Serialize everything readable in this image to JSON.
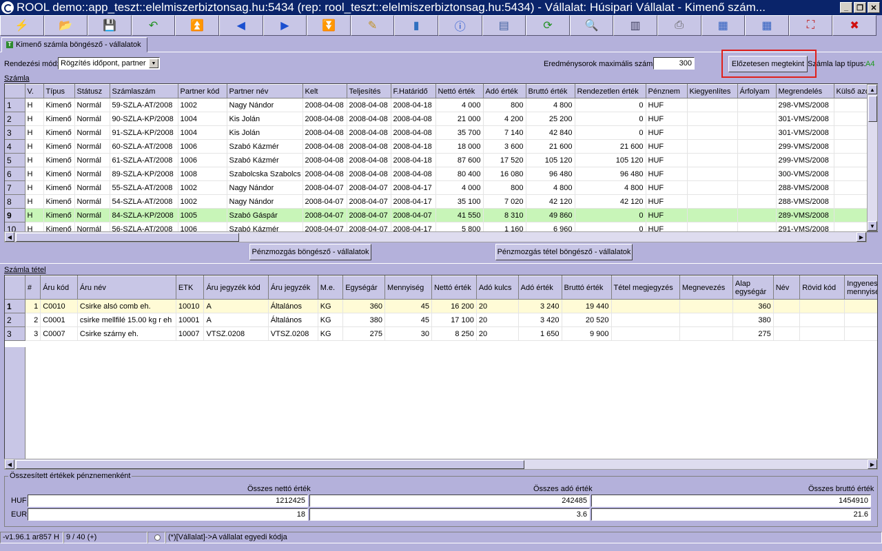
{
  "window": {
    "title": "ROOL demo::app_teszt::elelmiszerbiztonsag.hu:5434 (rep: rool_teszt::elelmiszerbiztonsag.hu:5434) - Vállalat: Húsipari Vállalat - Kimenő szám..."
  },
  "toolbar": {
    "buttons": [
      {
        "name": "new-icon",
        "glyph": "⚡",
        "color": "#d4781a"
      },
      {
        "name": "open-icon",
        "glyph": "📂",
        "color": "#3060c0"
      },
      {
        "name": "save-icon",
        "glyph": "💾",
        "color": "#303060"
      },
      {
        "name": "undo-icon",
        "glyph": "↶",
        "color": "#209020"
      },
      {
        "name": "first-record-icon",
        "glyph": "⏫",
        "color": "#1a4fd0"
      },
      {
        "name": "previous-record-icon",
        "glyph": "◀",
        "color": "#1a4fd0"
      },
      {
        "name": "next-record-icon",
        "glyph": "▶",
        "color": "#1a4fd0"
      },
      {
        "name": "last-record-icon",
        "glyph": "⏬",
        "color": "#1a4fd0"
      },
      {
        "name": "edit-icon",
        "glyph": "✎",
        "color": "#c09020"
      },
      {
        "name": "database-icon",
        "glyph": "▮",
        "color": "#3070c0"
      },
      {
        "name": "info-icon",
        "glyph": "ⓘ",
        "color": "#1a4fd0"
      },
      {
        "name": "layout-icon",
        "glyph": "▤",
        "color": "#4060a0"
      },
      {
        "name": "refresh-icon",
        "glyph": "⟳",
        "color": "#209020"
      },
      {
        "name": "search-icon",
        "glyph": "🔍",
        "color": "#3060c0"
      },
      {
        "name": "columns-icon",
        "glyph": "▥",
        "color": "#404060"
      },
      {
        "name": "print-icon",
        "glyph": "⎙",
        "color": "#606060"
      },
      {
        "name": "export-icon",
        "glyph": "▦",
        "color": "#3060c0"
      },
      {
        "name": "import-icon",
        "glyph": "▦",
        "color": "#3060c0"
      },
      {
        "name": "expand-icon",
        "glyph": "⛶",
        "color": "#c02020"
      },
      {
        "name": "close-icon",
        "glyph": "✖",
        "color": "#d01010"
      }
    ]
  },
  "tab": {
    "icon_letter": "T",
    "label": "Kimenő számla böngésző - vállalatok"
  },
  "controls": {
    "sort_label": "Rendezési mód:",
    "sort_value": "Rögzítés időpont, partner",
    "max_rows_label": "Eredménysorok maximális száma:",
    "max_rows_value": "300",
    "preview_button": "Előzetesen megtekint",
    "sheet_type_label": "Számla lap típus:",
    "sheet_type_value": "A4"
  },
  "invoices": {
    "section_label": "Számla",
    "columns": [
      "V.",
      "Típus",
      "Státusz",
      "Számlaszám",
      "Partner kód",
      "Partner név",
      "Kelt",
      "Teljesítés",
      "F.Határidő",
      "Nettó érték",
      "Adó érték",
      "Bruttó érték",
      "Rendezetlen érték",
      "Pénznem",
      "Kiegyenlítes",
      "Árfolyam",
      "Megrendelés",
      "Külső azo"
    ],
    "rows": [
      [
        "1",
        "H",
        "Kimenő",
        "Normál",
        "59-SZLA-AT/2008",
        "1002",
        "Nagy Nándor",
        "2008-04-08",
        "2008-04-08",
        "2008-04-18",
        "4 000",
        "800",
        "4 800",
        "0",
        "HUF",
        "",
        "",
        "298-VMS/2008",
        ""
      ],
      [
        "2",
        "H",
        "Kimenő",
        "Normál",
        "90-SZLA-KP/2008",
        "1004",
        "Kis Jolán",
        "2008-04-08",
        "2008-04-08",
        "2008-04-08",
        "21 000",
        "4 200",
        "25 200",
        "0",
        "HUF",
        "",
        "",
        "301-VMS/2008",
        ""
      ],
      [
        "3",
        "H",
        "Kimenő",
        "Normál",
        "91-SZLA-KP/2008",
        "1004",
        "Kis Jolán",
        "2008-04-08",
        "2008-04-08",
        "2008-04-08",
        "35 700",
        "7 140",
        "42 840",
        "0",
        "HUF",
        "",
        "",
        "301-VMS/2008",
        ""
      ],
      [
        "4",
        "H",
        "Kimenő",
        "Normál",
        "60-SZLA-AT/2008",
        "1006",
        "Szabó Kázmér",
        "2008-04-08",
        "2008-04-08",
        "2008-04-18",
        "18 000",
        "3 600",
        "21 600",
        "21 600",
        "HUF",
        "",
        "",
        "299-VMS/2008",
        ""
      ],
      [
        "5",
        "H",
        "Kimenő",
        "Normál",
        "61-SZLA-AT/2008",
        "1006",
        "Szabó Kázmér",
        "2008-04-08",
        "2008-04-08",
        "2008-04-18",
        "87 600",
        "17 520",
        "105 120",
        "105 120",
        "HUF",
        "",
        "",
        "299-VMS/2008",
        ""
      ],
      [
        "6",
        "H",
        "Kimenő",
        "Normál",
        "89-SZLA-KP/2008",
        "1008",
        "Szabolcska Szabolcs",
        "2008-04-08",
        "2008-04-08",
        "2008-04-08",
        "80 400",
        "16 080",
        "96 480",
        "96 480",
        "HUF",
        "",
        "",
        "300-VMS/2008",
        ""
      ],
      [
        "7",
        "H",
        "Kimenő",
        "Normál",
        "55-SZLA-AT/2008",
        "1002",
        "Nagy Nándor",
        "2008-04-07",
        "2008-04-07",
        "2008-04-17",
        "4 000",
        "800",
        "4 800",
        "4 800",
        "HUF",
        "",
        "",
        "288-VMS/2008",
        ""
      ],
      [
        "8",
        "H",
        "Kimenő",
        "Normál",
        "54-SZLA-AT/2008",
        "1002",
        "Nagy Nándor",
        "2008-04-07",
        "2008-04-07",
        "2008-04-17",
        "35 100",
        "7 020",
        "42 120",
        "42 120",
        "HUF",
        "",
        "",
        "288-VMS/2008",
        ""
      ],
      [
        "9",
        "H",
        "Kimenő",
        "Normál",
        "84-SZLA-KP/2008",
        "1005",
        "Szabó Gáspár",
        "2008-04-07",
        "2008-04-07",
        "2008-04-07",
        "41 550",
        "8 310",
        "49 860",
        "0",
        "HUF",
        "",
        "",
        "289-VMS/2008",
        ""
      ],
      [
        "10",
        "H",
        "Kimenő",
        "Normál",
        "56-SZLA-AT/2008",
        "1006",
        "Szabó Kázmér",
        "2008-04-07",
        "2008-04-07",
        "2008-04-17",
        "5 800",
        "1 160",
        "6 960",
        "0",
        "HUF",
        "",
        "",
        "291-VMS/2008",
        ""
      ]
    ],
    "selected_row": 8
  },
  "buttons": {
    "cash_browser": "Pénzmozgás böngésző - vállalatok",
    "cash_item_browser": "Pénzmozgás tétel böngésző - vállalatok"
  },
  "items": {
    "section_label": "Számla tétel",
    "columns": [
      "#",
      "Áru kód",
      "Áru név",
      "ETK",
      "Áru jegyzék kód",
      "Áru jegyzék",
      "M.e.",
      "Egységár",
      "Mennyiség",
      "Nettó érték",
      "Adó kulcs",
      "Adó érték",
      "Bruttó érték",
      "Tétel megjegyzés",
      "Megnevezés",
      "Alap egységár",
      "Név",
      "Rövid kód",
      "Ingyenes mennyiség"
    ],
    "rows": [
      [
        "1",
        "1",
        "C0010",
        "Csirke alsó comb eh.",
        "10010",
        "A",
        "Általános",
        "KG",
        "360",
        "45",
        "16 200",
        "20",
        "3 240",
        "19 440",
        "",
        "",
        "360",
        "",
        "",
        ""
      ],
      [
        "2",
        "2",
        "C0001",
        " csirke mellfilé 15.00 kg r eh",
        "10001",
        "A",
        "Általános",
        "KG",
        "380",
        "45",
        "17 100",
        "20",
        "3 420",
        "20 520",
        "",
        "",
        "380",
        "",
        "",
        ""
      ],
      [
        "3",
        "3",
        "C0007",
        "Csirke szárny eh.",
        "10007",
        "VTSZ.0208",
        "VTSZ.0208",
        "KG",
        "275",
        "30",
        "8 250",
        "20",
        "1 650",
        "9 900",
        "",
        "",
        "275",
        "",
        "",
        ""
      ]
    ],
    "selected_row": 0
  },
  "summary": {
    "legend": "Összesített értékek pénznemenként",
    "net_label": "Összes nettó érték",
    "tax_label": "Összes adó érték",
    "gross_label": "Összes bruttó érték",
    "rows": [
      {
        "currency": "HUF",
        "net": "1212425",
        "tax": "242485",
        "gross": "1454910"
      },
      {
        "currency": "EUR",
        "net": "18",
        "tax": "3.6",
        "gross": "21.6"
      }
    ]
  },
  "statusbar": {
    "version": "-v1.96.1 ar857 H",
    "record": "9 / 40 (+)",
    "hint": "(*)[Vállalat]->A vállalat egyedi kódja"
  },
  "colors": {
    "selected_invoice_row": "#c8f5b8",
    "selected_item_row": "#fffbd6",
    "highlight_box": "#e0201a",
    "title_bar": "#0a246a"
  }
}
